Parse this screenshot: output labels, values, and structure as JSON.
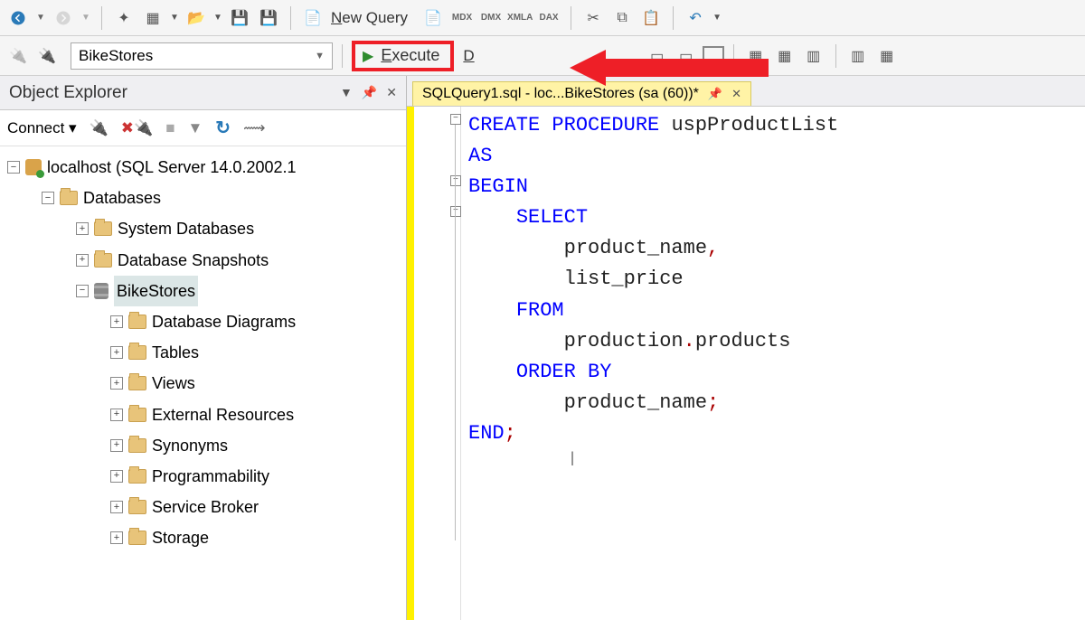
{
  "toolbar1": {
    "new_query": "New Query",
    "query_icons": [
      "MDX",
      "DMX",
      "XMLA",
      "DAX"
    ]
  },
  "toolbar2": {
    "database": "BikeStores",
    "execute": "Execute",
    "debug_partial": "D"
  },
  "object_explorer": {
    "title": "Object Explorer",
    "connect": "Connect",
    "server": "localhost (SQL Server 14.0.2002.1",
    "nodes": {
      "databases": "Databases",
      "system_db": "System Databases",
      "snapshots": "Database Snapshots",
      "bikestores": "BikeStores",
      "children": [
        "Database Diagrams",
        "Tables",
        "Views",
        "External Resources",
        "Synonyms",
        "Programmability",
        "Service Broker",
        "Storage"
      ]
    }
  },
  "editor": {
    "tab_title": "SQLQuery1.sql - loc...BikeStores (sa (60))*",
    "code_tokens": [
      [
        {
          "t": "CREATE",
          "c": "kw"
        },
        {
          "t": " ",
          "c": ""
        },
        {
          "t": "PROCEDURE",
          "c": "kw"
        },
        {
          "t": " uspProductList",
          "c": "ident"
        }
      ],
      [
        {
          "t": "AS",
          "c": "kw"
        }
      ],
      [
        {
          "t": "BEGIN",
          "c": "kw"
        }
      ],
      [
        {
          "t": "    ",
          "c": ""
        },
        {
          "t": "SELECT",
          "c": "kw"
        }
      ],
      [
        {
          "t": "        product_name",
          "c": "ident"
        },
        {
          "t": ",",
          "c": "kw-red"
        }
      ],
      [
        {
          "t": "        list_price",
          "c": "ident"
        }
      ],
      [
        {
          "t": "    ",
          "c": ""
        },
        {
          "t": "FROM",
          "c": "kw"
        }
      ],
      [
        {
          "t": "        production",
          "c": "ident"
        },
        {
          "t": ".",
          "c": "kw-red"
        },
        {
          "t": "products",
          "c": "ident"
        }
      ],
      [
        {
          "t": "    ",
          "c": ""
        },
        {
          "t": "ORDER",
          "c": "kw"
        },
        {
          "t": " ",
          "c": ""
        },
        {
          "t": "BY",
          "c": "kw"
        }
      ],
      [
        {
          "t": "        product_name",
          "c": "ident"
        },
        {
          "t": ";",
          "c": "kw-red"
        }
      ],
      [
        {
          "t": "END",
          "c": "kw"
        },
        {
          "t": ";",
          "c": "kw-red"
        }
      ]
    ]
  }
}
